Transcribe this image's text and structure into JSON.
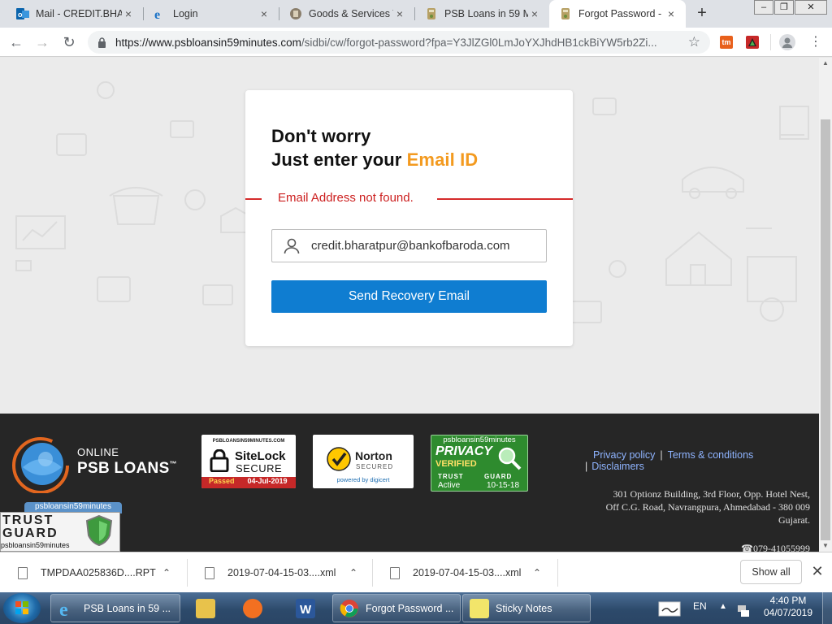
{
  "browser": {
    "tabs": [
      {
        "title": "Mail - CREDIT.BHAF",
        "close": "×",
        "favicon": "outlook-icon"
      },
      {
        "title": "Login",
        "close": "×",
        "favicon": "ie-icon"
      },
      {
        "title": "Goods & Services T",
        "close": "×",
        "favicon": "gst-icon"
      },
      {
        "title": "PSB Loans in 59 Mi",
        "close": "×",
        "favicon": "psb-icon"
      },
      {
        "title": "Forgot Password - ",
        "close": "×",
        "favicon": "psb-icon",
        "active": true
      }
    ],
    "new_tab": "+",
    "window_controls": [
      "–",
      "❐",
      "✕"
    ],
    "url_host": "https://www.psbloansin59minutes.com",
    "url_path": "/sidbi/cw/forgot-password?fpa=Y3JlZGl0LmJoYXJhdHB1ckBiYW5rb2Zi...",
    "extension_labels": [
      "tm"
    ]
  },
  "card": {
    "heading_line1": "Don't worry",
    "heading_line2_prefix": "Just enter your ",
    "heading_line2_accent": "Email ID",
    "error_message": "Email Address not found.",
    "email_value": "credit.bharatpur@bankofbaroda.com",
    "send_button": "Send Recovery Email"
  },
  "footer": {
    "logo_line1": "ONLINE",
    "logo_line2": "PSB LOANS",
    "logo_tm": "™",
    "sitelock_top": "PSBLOANSIN59MINUTES.COM",
    "sitelock_name": "SiteLock",
    "sitelock_secure": "SECURE",
    "sitelock_passed": "Passed",
    "sitelock_date": "04-Jul-2019",
    "norton_name": "Norton",
    "norton_secured": "SECURED",
    "norton_powered": "powered by digicert",
    "privacy_site": "psbloansin59minutes",
    "privacy_line1": "PRIVACY",
    "privacy_line2": "VERIFIED",
    "privacy_trust": "TRUST",
    "privacy_guard": "GUARD",
    "privacy_active": "Active",
    "privacy_date": "10-15-18",
    "trustguard_site": "psbloansin59minutes",
    "trustguard_line1": "TRUST",
    "trustguard_line2": "GUARD",
    "trustguard_bottom": "psbloansin59minutes",
    "links": [
      "Privacy policy",
      "Terms & conditions",
      "Disclaimers"
    ],
    "address_lines": [
      "301 Optionz Building, 3rd Floor, Opp. Hotel Nest,",
      "Off C.G. Road, Navrangpura, Ahmedabad - 380 009",
      "Gujarat."
    ],
    "phone": "☎079-41055999"
  },
  "downloads": {
    "items": [
      {
        "name": "TMPDAA025836D....RPT"
      },
      {
        "name": "2019-07-04-15-03....xml"
      },
      {
        "name": "2019-07-04-15-03....xml"
      }
    ],
    "show_all": "Show all",
    "close": "✕"
  },
  "taskbar": {
    "items": [
      {
        "label": "PSB Loans in 59 ...",
        "icon": "ie-icon"
      },
      {
        "label": "",
        "icon": "file-explorer-icon"
      },
      {
        "label": "",
        "icon": "media-player-icon"
      },
      {
        "label": "",
        "icon": "word-icon"
      },
      {
        "label": "Forgot Password ...",
        "icon": "chrome-icon"
      },
      {
        "label": "Sticky Notes",
        "icon": "sticky-notes-icon"
      }
    ],
    "language": "EN",
    "time": "4:40 PM",
    "date": "04/07/2019"
  },
  "colors": {
    "accent_orange": "#f39a1f",
    "error_red": "#d52b2b",
    "button_blue": "#0f7dd1",
    "footer_bg": "#262626"
  }
}
